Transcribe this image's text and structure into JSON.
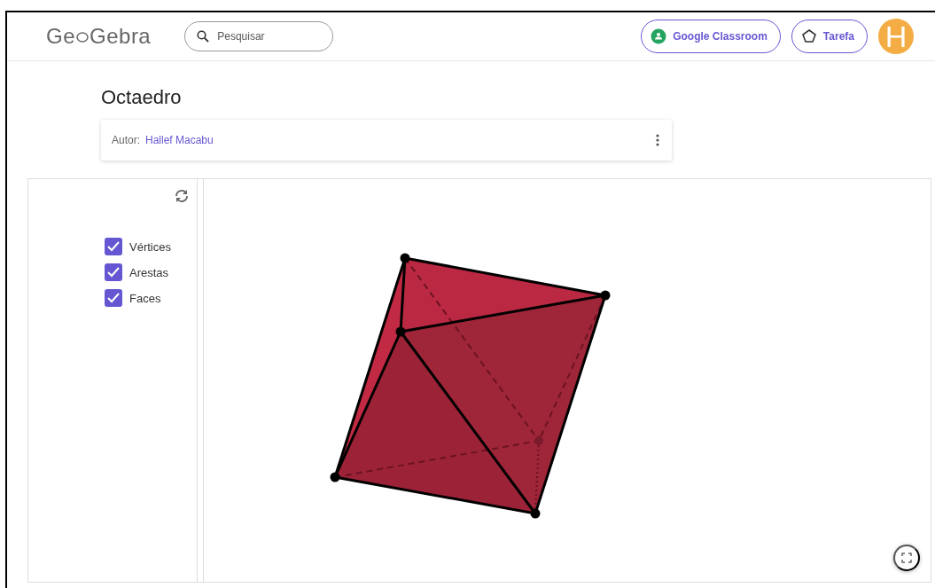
{
  "header": {
    "logo": {
      "before": "Ge",
      "after": "Gebra"
    },
    "search": {
      "placeholder": "Pesquisar"
    },
    "buttons": [
      {
        "kind": "classroom",
        "label": "Google Classroom"
      },
      {
        "kind": "task",
        "label": "Tarefa"
      }
    ],
    "avatar": "H"
  },
  "title": "Octaedro",
  "author": {
    "label": "Autor:",
    "name": "Hallef Macabu"
  },
  "applet": {
    "checkboxes": [
      {
        "label": "Vértices",
        "checked": true
      },
      {
        "label": "Arestas",
        "checked": true
      },
      {
        "label": "Faces",
        "checked": true
      }
    ]
  }
}
